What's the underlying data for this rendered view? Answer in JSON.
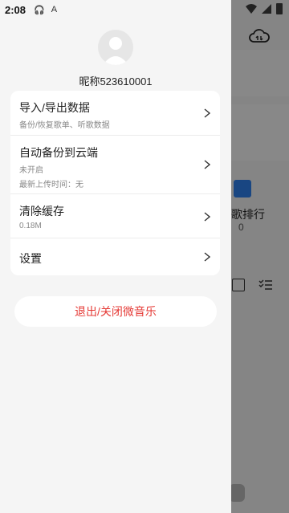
{
  "status_bar": {
    "time": "2:08",
    "icon_a": "A"
  },
  "profile": {
    "nickname": "昵称523610001"
  },
  "menu": [
    {
      "title": "导入/导出数据",
      "subtitle": "备份/恢复歌单、听歌数据"
    },
    {
      "title": "自动备份到云端",
      "subtitle": "未开启",
      "subtitle2": "最新上传时间：无"
    },
    {
      "title": "清除缓存",
      "subtitle": "0.18M"
    },
    {
      "title": "设置"
    }
  ],
  "exit_label": "退出/关闭微音乐",
  "background": {
    "rank_label": "歌排行",
    "rank_count": "0"
  },
  "colors": {
    "exit_text": "#e53935",
    "rank_icon": "#2f80ed"
  }
}
